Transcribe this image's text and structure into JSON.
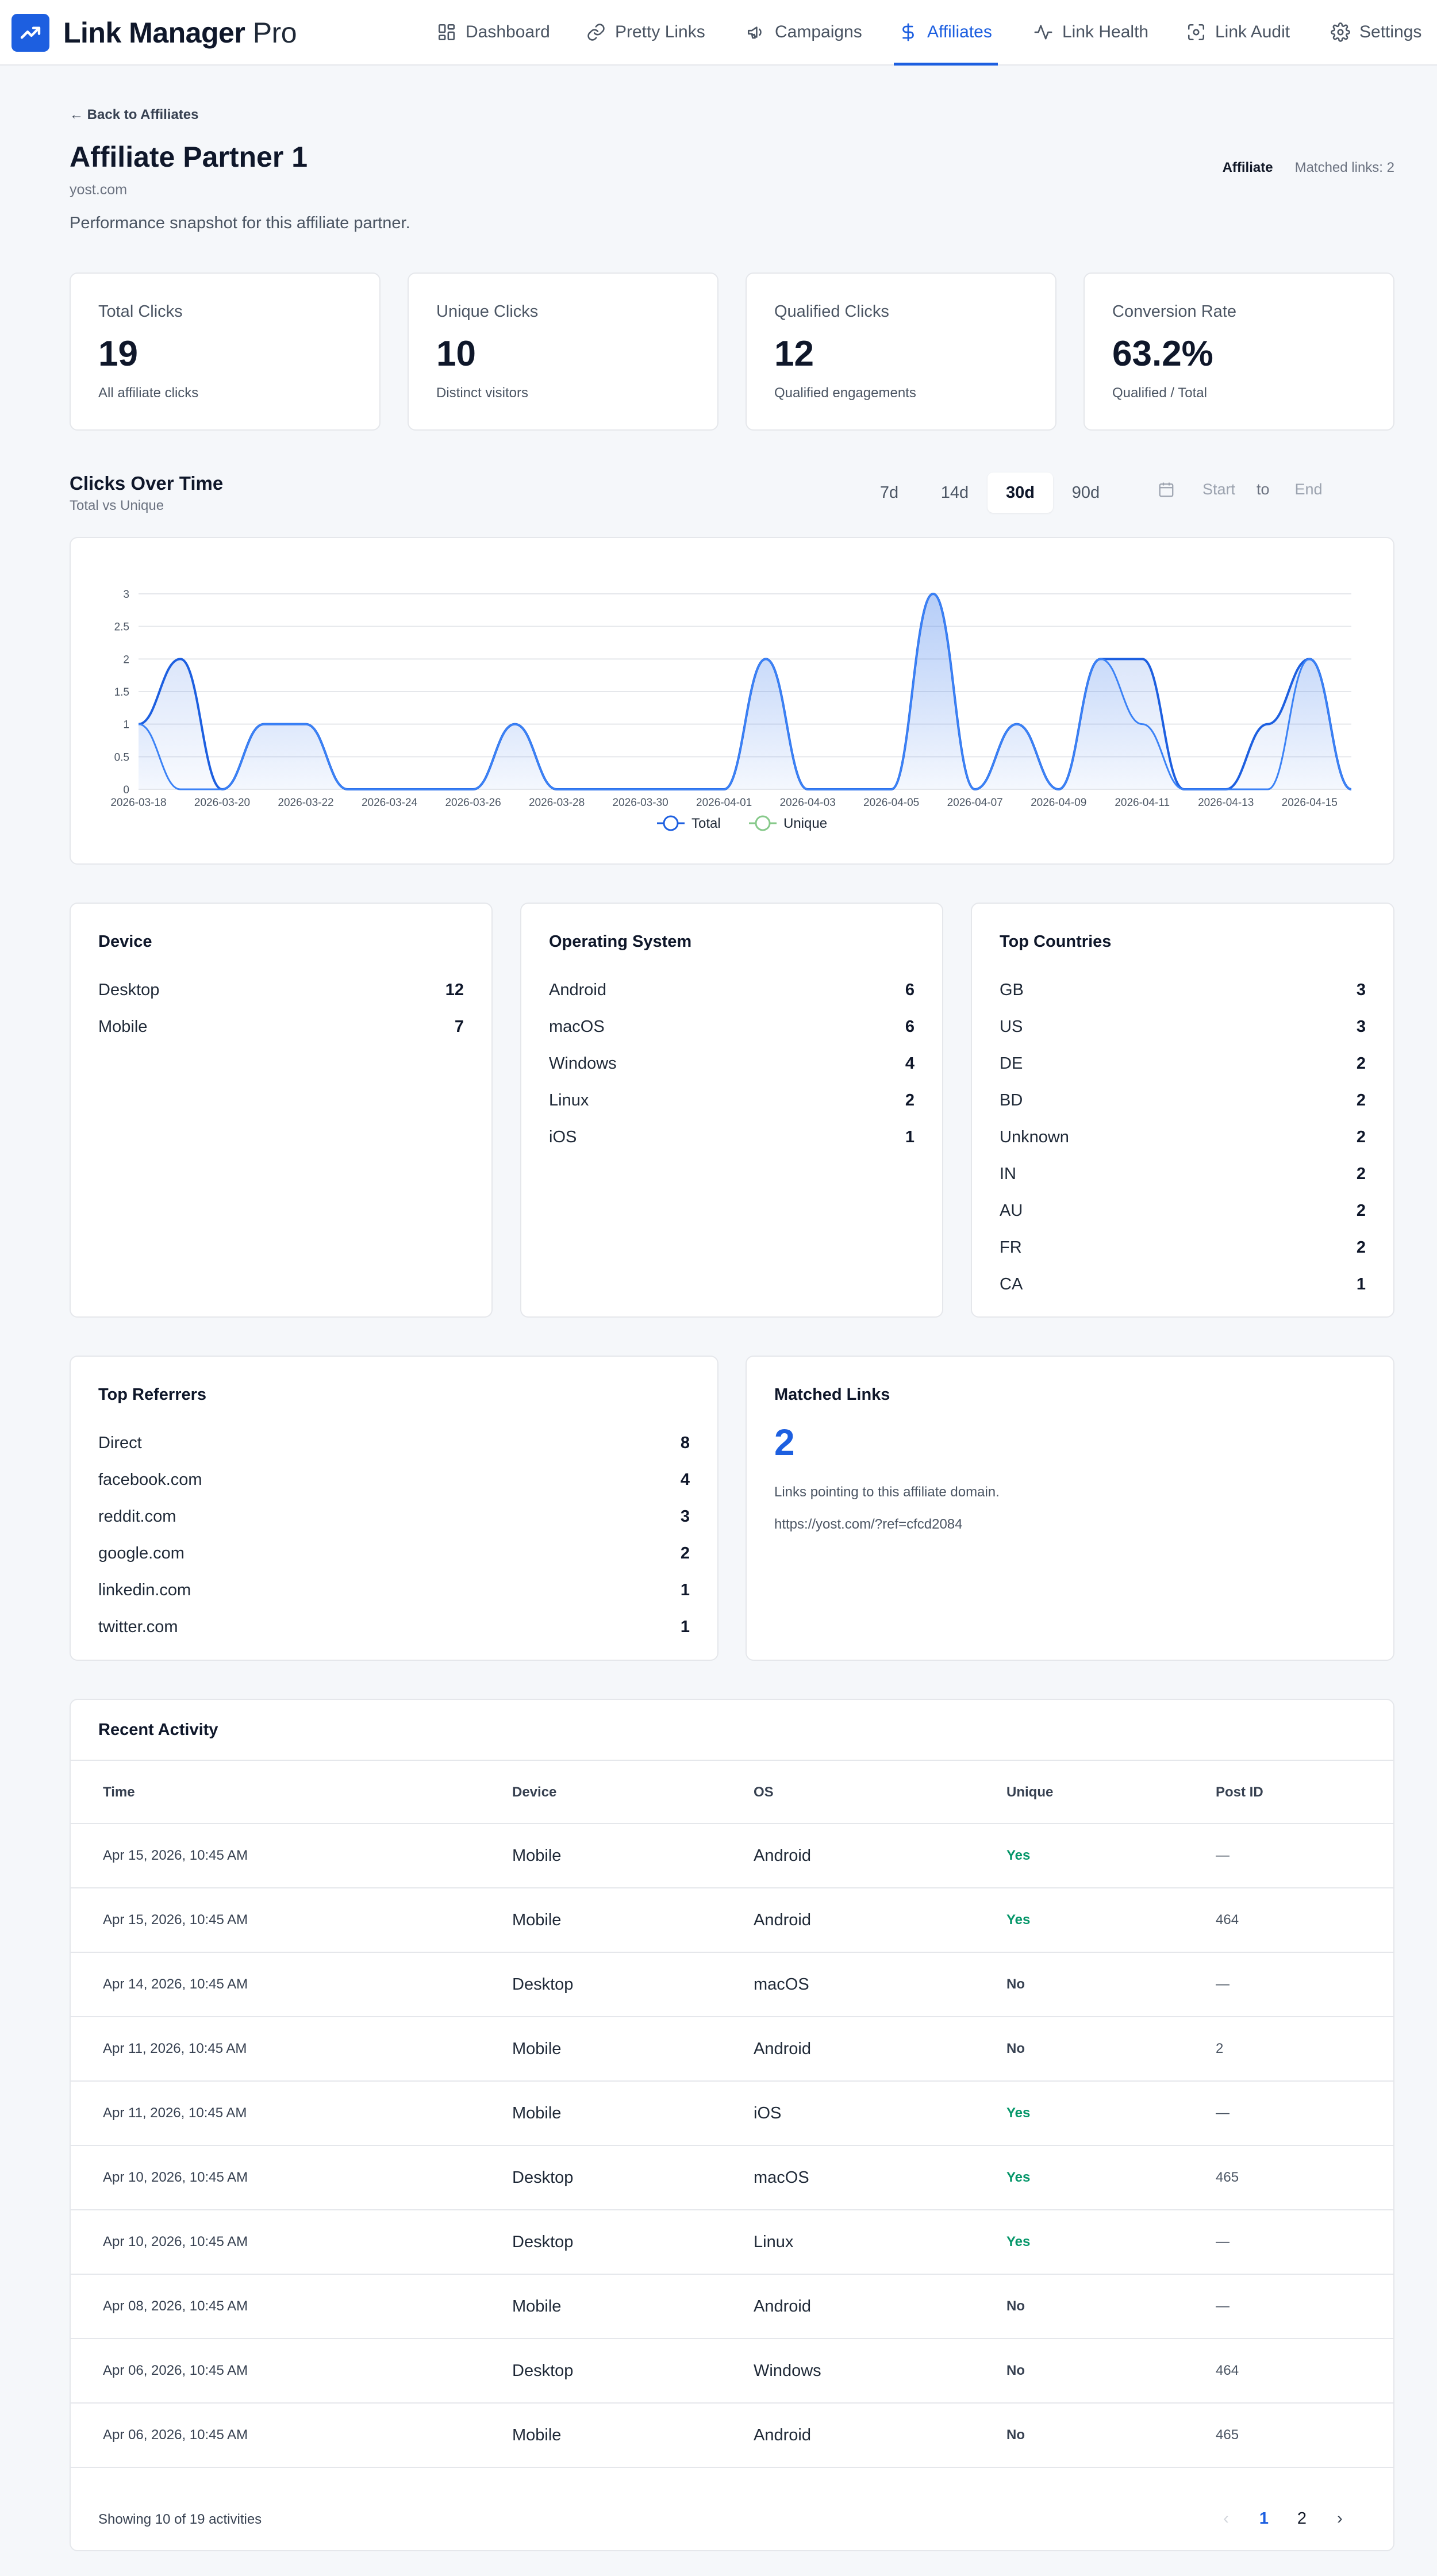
{
  "app": {
    "name_bold": "Link Manager",
    "name_light": "Pro"
  },
  "nav": [
    {
      "label": "Dashboard",
      "icon": "dashboard-icon"
    },
    {
      "label": "Pretty Links",
      "icon": "link-icon"
    },
    {
      "label": "Campaigns",
      "icon": "megaphone-icon"
    },
    {
      "label": "Affiliates",
      "icon": "dollar-icon",
      "active": true
    },
    {
      "label": "Link Health",
      "icon": "activity-icon"
    },
    {
      "label": "Link Audit",
      "icon": "scan-icon"
    },
    {
      "label": "Settings",
      "icon": "gear-icon"
    }
  ],
  "page": {
    "back_label": "← Back to Affiliates",
    "title": "Affiliate Partner 1",
    "domain": "yost.com",
    "description": "Performance snapshot for this affiliate partner.",
    "tag": "Affiliate",
    "matched_links": "Matched links: 2"
  },
  "stats": [
    {
      "label": "Total Clicks",
      "value": "19",
      "sub": "All affiliate clicks"
    },
    {
      "label": "Unique Clicks",
      "value": "10",
      "sub": "Distinct visitors"
    },
    {
      "label": "Qualified Clicks",
      "value": "12",
      "sub": "Qualified engagements"
    },
    {
      "label": "Conversion Rate",
      "value": "63.2%",
      "sub": "Qualified / Total"
    }
  ],
  "clicks_section": {
    "title": "Clicks Over Time",
    "subtitle": "Total vs Unique",
    "ranges": [
      "7d",
      "14d",
      "30d",
      "90d"
    ],
    "active_range": "30d",
    "start_placeholder": "Start",
    "to_label": "to",
    "end_placeholder": "End"
  },
  "chart_data": {
    "type": "area",
    "x": [
      "2026-03-18",
      "2026-03-19",
      "2026-03-20",
      "2026-03-21",
      "2026-03-22",
      "2026-03-23",
      "2026-03-24",
      "2026-03-25",
      "2026-03-26",
      "2026-03-27",
      "2026-03-28",
      "2026-03-29",
      "2026-03-30",
      "2026-03-31",
      "2026-04-01",
      "2026-04-02",
      "2026-04-03",
      "2026-04-04",
      "2026-04-05",
      "2026-04-06",
      "2026-04-07",
      "2026-04-08",
      "2026-04-09",
      "2026-04-10",
      "2026-04-11",
      "2026-04-12",
      "2026-04-13",
      "2026-04-14",
      "2026-04-15",
      "2026-04-16"
    ],
    "x_tick_labels": [
      "2026-03-18",
      "2026-03-20",
      "2026-03-22",
      "2026-03-24",
      "2026-03-26",
      "2026-03-28",
      "2026-03-30",
      "2026-04-01",
      "2026-04-03",
      "2026-04-05",
      "2026-04-07",
      "2026-04-09",
      "2026-04-11",
      "2026-04-13",
      "2026-04-15"
    ],
    "series": [
      {
        "name": "Total",
        "color": "#1d5fe0",
        "values": [
          1,
          2,
          0,
          1,
          1,
          0,
          0,
          0,
          0,
          1,
          0,
          0,
          0,
          0,
          0,
          2,
          0,
          0,
          0,
          3,
          0,
          1,
          0,
          2,
          2,
          0,
          0,
          1,
          2,
          0
        ]
      },
      {
        "name": "Unique",
        "color": "#3b82f6",
        "values": [
          1,
          0,
          0,
          1,
          1,
          0,
          0,
          0,
          0,
          1,
          0,
          0,
          0,
          0,
          0,
          2,
          0,
          0,
          0,
          3,
          0,
          1,
          0,
          2,
          1,
          0,
          0,
          0,
          2,
          0
        ]
      }
    ],
    "ylim": [
      0,
      3
    ],
    "yticks": [
      "0",
      "0.5",
      "1",
      "1.5",
      "2",
      "2.5",
      "3"
    ],
    "grid": true,
    "legend": "bottom"
  },
  "device": {
    "title": "Device",
    "items": [
      {
        "label": "Desktop",
        "value": "12"
      },
      {
        "label": "Mobile",
        "value": "7"
      }
    ]
  },
  "os": {
    "title": "Operating System",
    "items": [
      {
        "label": "Android",
        "value": "6"
      },
      {
        "label": "macOS",
        "value": "6"
      },
      {
        "label": "Windows",
        "value": "4"
      },
      {
        "label": "Linux",
        "value": "2"
      },
      {
        "label": "iOS",
        "value": "1"
      }
    ]
  },
  "countries": {
    "title": "Top Countries",
    "items": [
      {
        "label": "GB",
        "value": "3"
      },
      {
        "label": "US",
        "value": "3"
      },
      {
        "label": "DE",
        "value": "2"
      },
      {
        "label": "BD",
        "value": "2"
      },
      {
        "label": "Unknown",
        "value": "2"
      },
      {
        "label": "IN",
        "value": "2"
      },
      {
        "label": "AU",
        "value": "2"
      },
      {
        "label": "FR",
        "value": "2"
      },
      {
        "label": "CA",
        "value": "1"
      }
    ]
  },
  "referrers": {
    "title": "Top Referrers",
    "items": [
      {
        "label": "Direct",
        "value": "8"
      },
      {
        "label": "facebook.com",
        "value": "4"
      },
      {
        "label": "reddit.com",
        "value": "3"
      },
      {
        "label": "google.com",
        "value": "2"
      },
      {
        "label": "linkedin.com",
        "value": "1"
      },
      {
        "label": "twitter.com",
        "value": "1"
      }
    ]
  },
  "matched": {
    "title": "Matched Links",
    "value": "2",
    "description": "Links pointing to this affiliate domain.",
    "link": "https://yost.com/?ref=cfcd2084"
  },
  "activity": {
    "title": "Recent Activity",
    "columns": [
      "Time",
      "Device",
      "OS",
      "Unique",
      "Post ID"
    ],
    "rows": [
      {
        "time": "Apr 15, 2026, 10:45 AM",
        "device": "Mobile",
        "os": "Android",
        "unique": "Yes",
        "post": "—"
      },
      {
        "time": "Apr 15, 2026, 10:45 AM",
        "device": "Mobile",
        "os": "Android",
        "unique": "Yes",
        "post": "464"
      },
      {
        "time": "Apr 14, 2026, 10:45 AM",
        "device": "Desktop",
        "os": "macOS",
        "unique": "No",
        "post": "—"
      },
      {
        "time": "Apr 11, 2026, 10:45 AM",
        "device": "Mobile",
        "os": "Android",
        "unique": "No",
        "post": "2"
      },
      {
        "time": "Apr 11, 2026, 10:45 AM",
        "device": "Mobile",
        "os": "iOS",
        "unique": "Yes",
        "post": "—"
      },
      {
        "time": "Apr 10, 2026, 10:45 AM",
        "device": "Desktop",
        "os": "macOS",
        "unique": "Yes",
        "post": "465"
      },
      {
        "time": "Apr 10, 2026, 10:45 AM",
        "device": "Desktop",
        "os": "Linux",
        "unique": "Yes",
        "post": "—"
      },
      {
        "time": "Apr 08, 2026, 10:45 AM",
        "device": "Mobile",
        "os": "Android",
        "unique": "No",
        "post": "—"
      },
      {
        "time": "Apr 06, 2026, 10:45 AM",
        "device": "Desktop",
        "os": "Windows",
        "unique": "No",
        "post": "464"
      },
      {
        "time": "Apr 06, 2026, 10:45 AM",
        "device": "Mobile",
        "os": "Android",
        "unique": "No",
        "post": "465"
      }
    ],
    "footer": "Showing 10 of 19 activities",
    "pages": [
      "1",
      "2"
    ],
    "current_page": "1"
  },
  "colors": {
    "accent": "#1d5fe0",
    "yes": "#059669",
    "background": "#f5f7fa"
  }
}
